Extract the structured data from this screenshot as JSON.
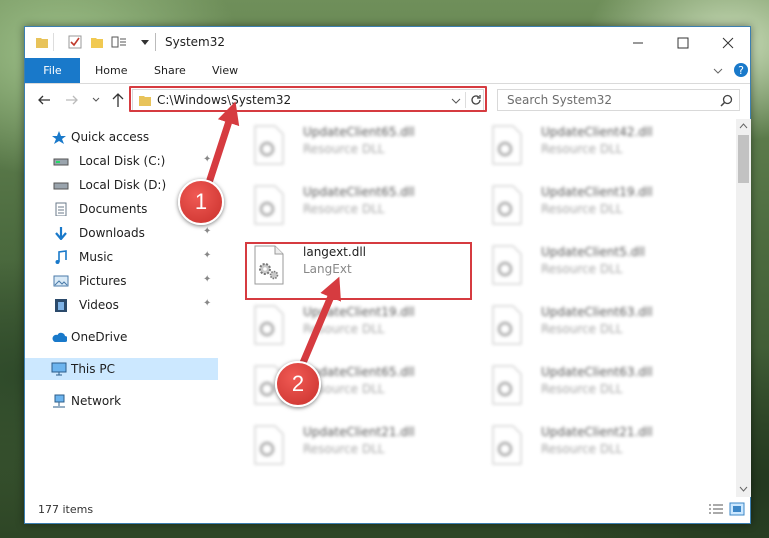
{
  "window": {
    "title": "System32"
  },
  "ribbon": {
    "tabs": [
      "File",
      "Home",
      "Share",
      "View"
    ]
  },
  "nav": {
    "address": "C:\\Windows\\System32",
    "search_placeholder": "Search System32"
  },
  "sidebar": {
    "items": [
      {
        "label": "Quick access",
        "icon": "star-icon"
      },
      {
        "label": "Local Disk (C:)",
        "icon": "drive-icon"
      },
      {
        "label": "Local Disk (D:)",
        "icon": "drive-icon"
      },
      {
        "label": "Documents",
        "icon": "documents-icon"
      },
      {
        "label": "Downloads",
        "icon": "download-arrow-icon"
      },
      {
        "label": "Music",
        "icon": "music-note-icon"
      },
      {
        "label": "Pictures",
        "icon": "pictures-icon"
      },
      {
        "label": "Videos",
        "icon": "film-icon"
      },
      {
        "label": "OneDrive",
        "icon": "cloud-icon"
      },
      {
        "label": "This PC",
        "icon": "monitor-icon"
      },
      {
        "label": "Network",
        "icon": "network-icon"
      }
    ]
  },
  "files": [
    {
      "name": "UpdateClient65.dll",
      "type": "Resource DLL"
    },
    {
      "name": "UpdateClient42.dll",
      "type": "Resource DLL"
    },
    {
      "name": "UpdateClient65.dll",
      "type": "Resource DLL"
    },
    {
      "name": "UpdateClient19.dll",
      "type": "Resource DLL"
    },
    {
      "name": "langext.dll",
      "type": "LangExt"
    },
    {
      "name": "UpdateClient5.dll",
      "type": "Resource DLL"
    },
    {
      "name": "UpdateClient19.dll",
      "type": "Resource DLL"
    },
    {
      "name": "UpdateClient63.dll",
      "type": "Resource DLL"
    },
    {
      "name": "UpdateClient65.dll",
      "type": "Resource DLL"
    },
    {
      "name": "UpdateClient63.dll",
      "type": "Resource DLL"
    },
    {
      "name": "UpdateClient21.dll",
      "type": "Resource DLL"
    },
    {
      "name": "UpdateClient21.dll",
      "type": "Resource DLL"
    }
  ],
  "status": {
    "item_count": "177 items"
  },
  "annotations": {
    "step1": "1",
    "step2": "2"
  },
  "colors": {
    "accent": "#1979ca",
    "highlight": "#d63b40"
  }
}
